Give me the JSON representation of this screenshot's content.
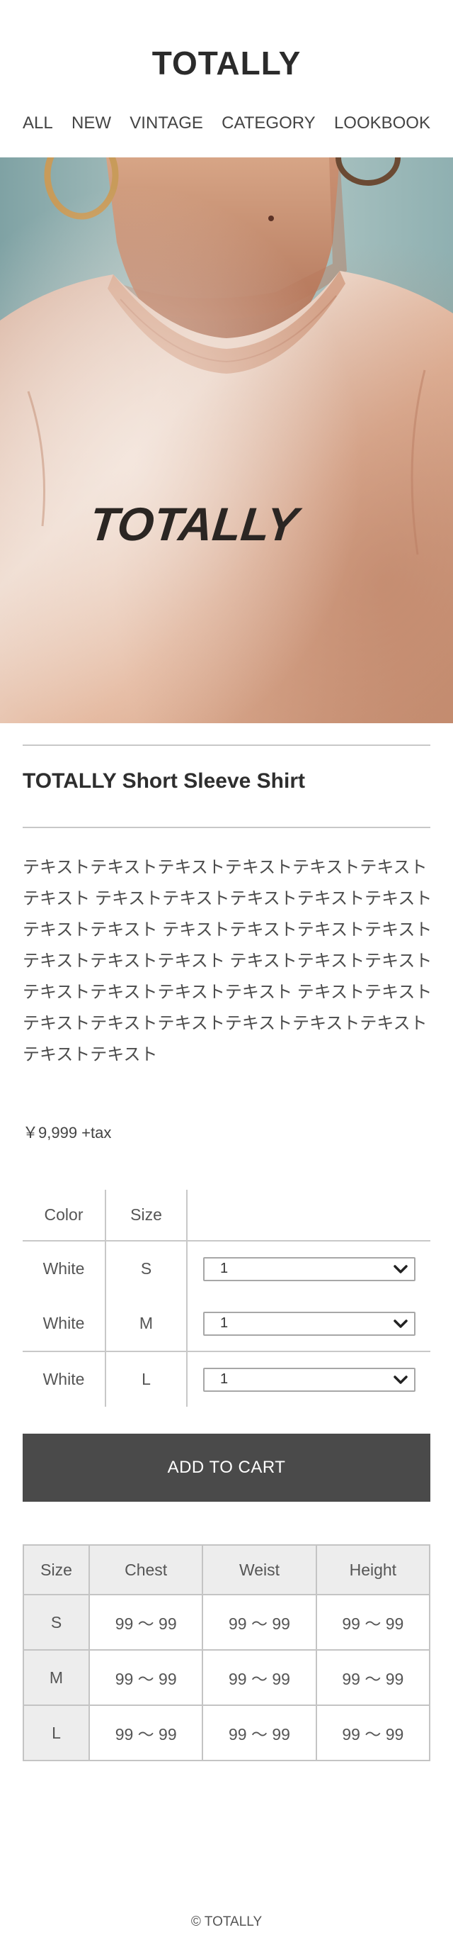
{
  "header": {
    "logo": "TOTALLY",
    "nav": [
      "ALL",
      "NEW",
      "VINTAGE",
      "CATEGORY",
      "LOOKBOOK"
    ]
  },
  "hero": {
    "print_text": "TOTALLY",
    "colors": {
      "shirt": "#e6c9b6",
      "background": "#9fb9b8",
      "skin": "#c58a6b"
    }
  },
  "product": {
    "title": "TOTALLY Short Sleeve Shirt",
    "description": "テキストテキストテキストテキストテキストテキストテキスト テキストテキストテキストテキストテキストテキストテキスト テキストテキストテキストテキストテキストテキストテキスト テキストテキストテキストテキストテキストテキストテキスト テキストテキストテキストテキストテキストテキストテキストテキストテキストテキスト",
    "price": "￥9,999 +tax"
  },
  "variants": {
    "headers": [
      "Color",
      "Size"
    ],
    "rows": [
      {
        "color": "White",
        "size": "S",
        "qty": "1"
      },
      {
        "color": "White",
        "size": "M",
        "qty": "1"
      },
      {
        "color": "White",
        "size": "L",
        "qty": "1"
      }
    ]
  },
  "cart": {
    "label": "ADD TO CART",
    "color": "#4a4a4a"
  },
  "size_chart": {
    "headers": [
      "Size",
      "Chest",
      "Weist",
      "Height"
    ],
    "rows": [
      [
        "S",
        "99 〜 99",
        "99 〜 99",
        "99 〜 99"
      ],
      [
        "M",
        "99 〜 99",
        "99 〜 99",
        "99 〜 99"
      ],
      [
        "L",
        "99 〜 99",
        "99 〜 99",
        "99 〜 99"
      ]
    ]
  },
  "footer": {
    "copyright": "© TOTALLY"
  }
}
